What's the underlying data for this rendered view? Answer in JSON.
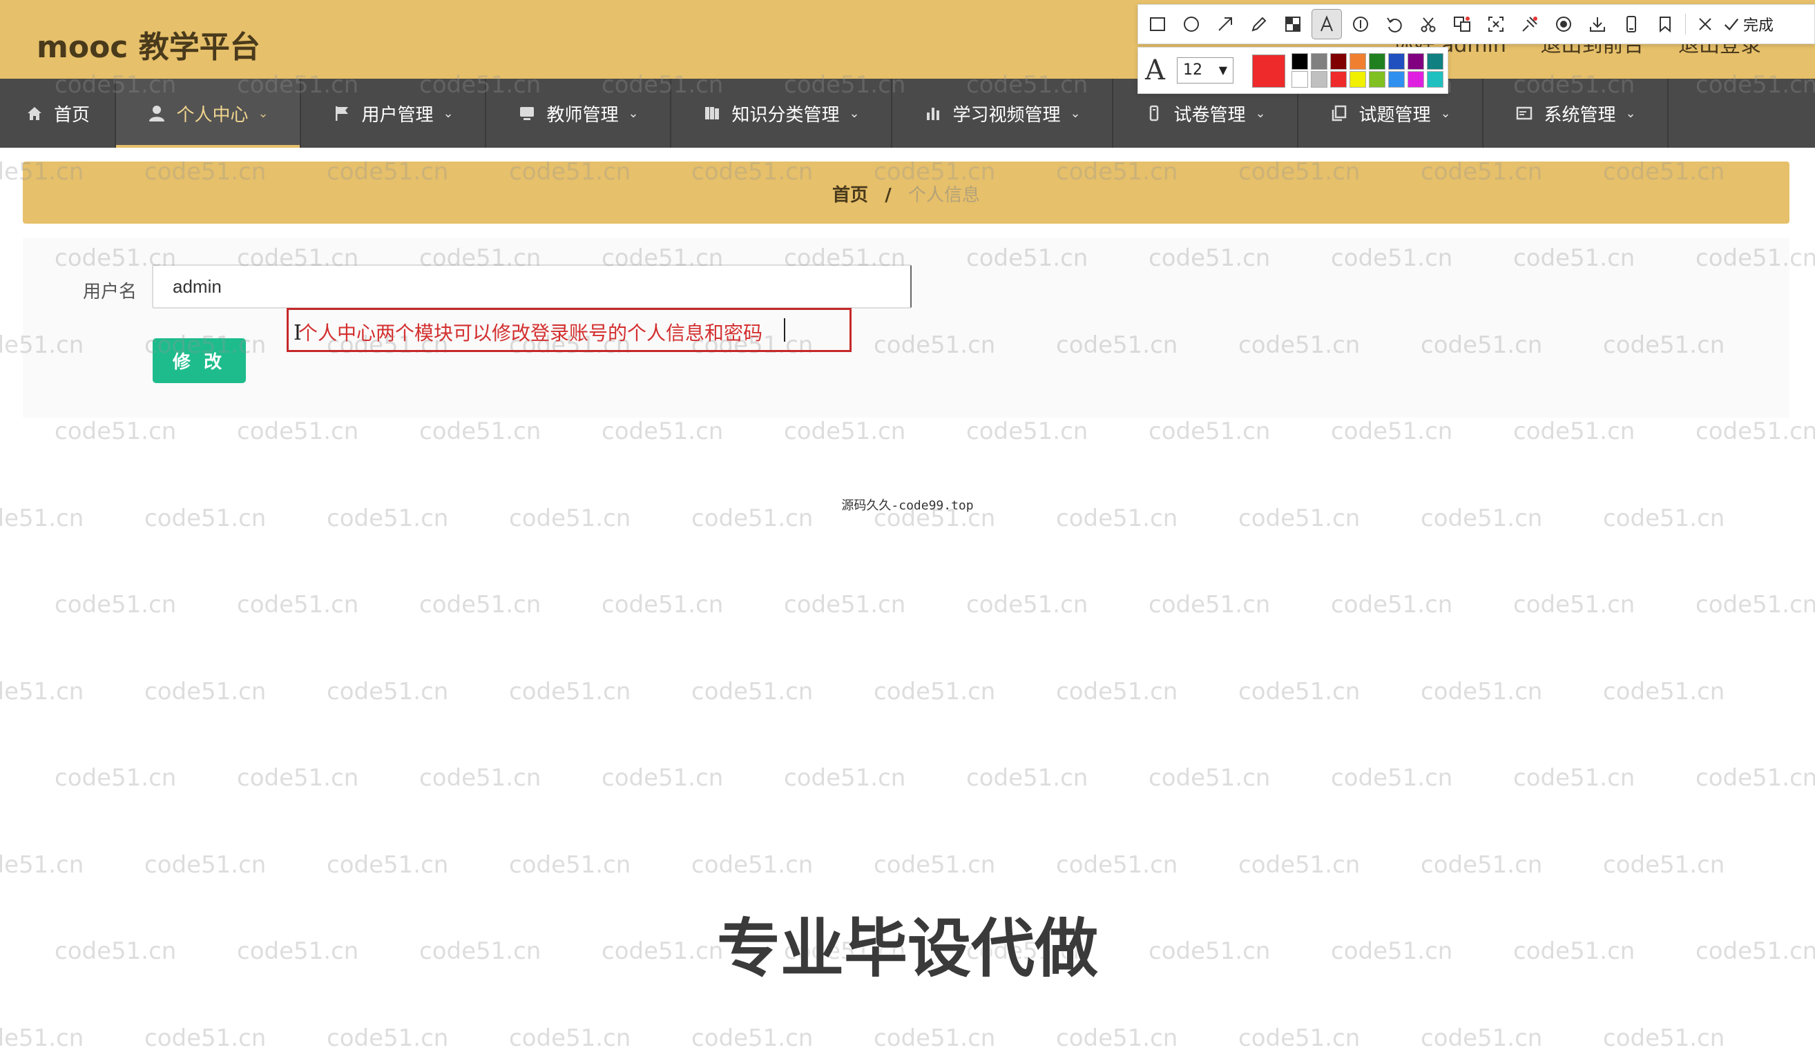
{
  "header": {
    "app_title": "mooc 教学平台",
    "user_link": "你好 admin",
    "back_link": "退出到前台",
    "logout_link": "退出登录"
  },
  "nav": {
    "items": [
      {
        "label": "首页",
        "icon": "home-icon"
      },
      {
        "label": "个人中心",
        "icon": "user-icon",
        "active": true
      },
      {
        "label": "用户管理",
        "icon": "flag-icon"
      },
      {
        "label": "教师管理",
        "icon": "monitor-icon"
      },
      {
        "label": "知识分类管理",
        "icon": "book-icon"
      },
      {
        "label": "学习视频管理",
        "icon": "bar-chart-icon"
      },
      {
        "label": "试卷管理",
        "icon": "paper-icon"
      },
      {
        "label": "试题管理",
        "icon": "copy-icon"
      },
      {
        "label": "系统管理",
        "icon": "window-icon"
      }
    ]
  },
  "breadcrumb": {
    "home": "首页",
    "separator": "/",
    "current": "个人信息"
  },
  "form": {
    "username_label": "用户名",
    "username_value": "admin",
    "modify_button": "修 改"
  },
  "annotation": {
    "text": "个人中心两个模块可以修改登录账号的个人信息和密码",
    "color": "#d32f2f"
  },
  "footer": {
    "source": "源码久久-code99.top"
  },
  "promo": {
    "text": "专业毕设代做"
  },
  "watermark": {
    "text": "code51.cn"
  },
  "toolbar": {
    "tools": [
      "rectangle-icon",
      "ellipse-icon",
      "arrow-icon",
      "pen-icon",
      "mosaic-icon",
      "text-icon",
      "number-icon",
      "undo-icon",
      "cut-icon",
      "translate-icon",
      "ocr-icon",
      "pin-icon",
      "record-icon",
      "download-icon",
      "phone-icon",
      "bookmark-icon",
      "close-icon"
    ],
    "selected": "text-icon",
    "finish_label": "完成",
    "font_size": "12",
    "current_color": "#ee2a2a",
    "palette": [
      "#000000",
      "#808080",
      "#800000",
      "#f08030",
      "#208020",
      "#2050c0",
      "#800080",
      "#108080",
      "#ffffff",
      "#c0c0c0",
      "#ee2a2a",
      "#f0f000",
      "#80c020",
      "#3090f0",
      "#e020e0",
      "#20c0c0"
    ]
  }
}
